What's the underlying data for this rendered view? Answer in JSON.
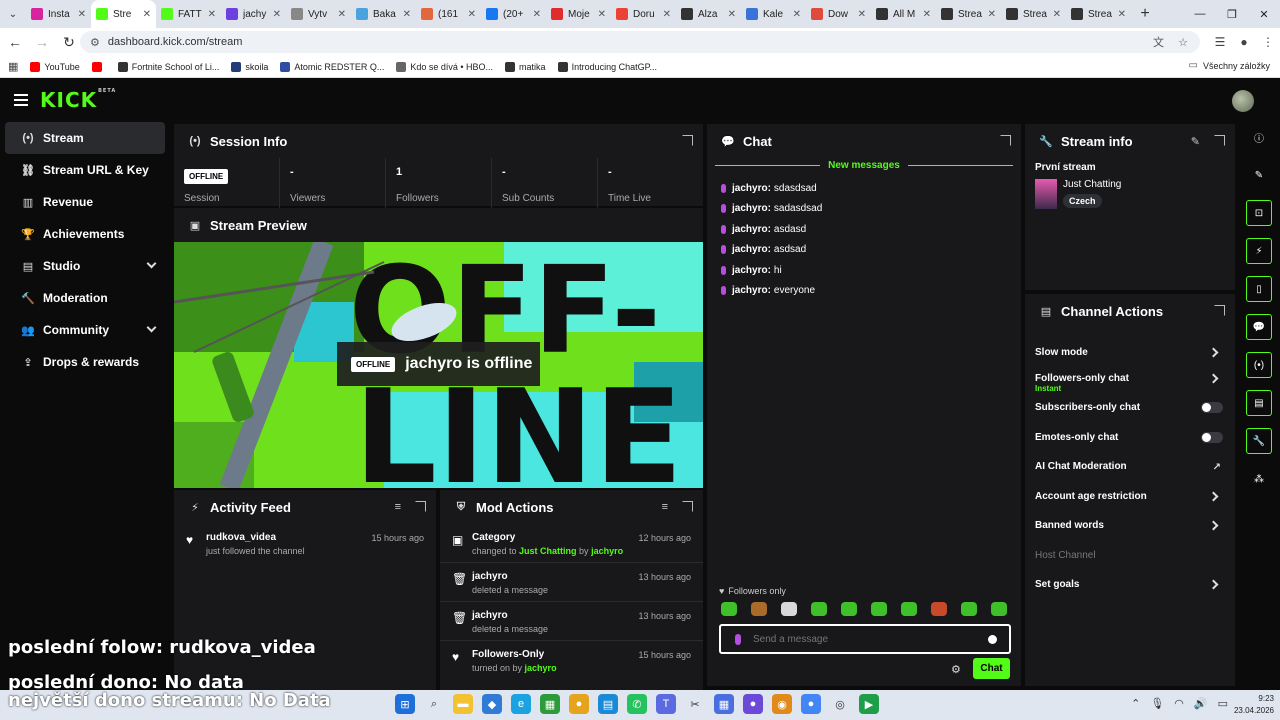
{
  "browser": {
    "tabs": [
      {
        "label": "Insta",
        "color": "#d6249f"
      },
      {
        "label": "Stre",
        "color": "#53fc18",
        "active": true
      },
      {
        "label": "FATT",
        "color": "#53fc18"
      },
      {
        "label": "jachy",
        "color": "#6d3fe0"
      },
      {
        "label": "Vytv",
        "color": "#888888"
      },
      {
        "label": "Baka",
        "color": "#4aa3df"
      },
      {
        "label": "(161",
        "color": "#e2673c"
      },
      {
        "label": "(20+",
        "color": "#1877f2"
      },
      {
        "label": "Moje",
        "color": "#e02c2c"
      },
      {
        "label": "Doru",
        "color": "#ea4335"
      },
      {
        "label": "Alza",
        "color": "#333333"
      },
      {
        "label": "Kale",
        "color": "#3a73d8"
      },
      {
        "label": "Dow",
        "color": "#e04a3c"
      },
      {
        "label": "All M",
        "color": "#333333"
      },
      {
        "label": "Strea",
        "color": "#333333"
      },
      {
        "label": "Strea",
        "color": "#333333"
      },
      {
        "label": "Strea",
        "color": "#333333"
      }
    ],
    "address": "dashboard.kick.com/stream",
    "bookmarks": [
      {
        "label": "YouTube",
        "color": "#ff0000"
      },
      {
        "label": "",
        "color": "#ff0000"
      },
      {
        "label": "Fortnite School of Li...",
        "color": "#333333"
      },
      {
        "label": "skoila",
        "color": "#223c7a"
      },
      {
        "label": "Atomic REDSTER Q...",
        "color": "#2d4fa3"
      },
      {
        "label": "Kdo se dívá • HBO...",
        "color": "#666666"
      },
      {
        "label": "matika",
        "color": "#333333"
      },
      {
        "label": "Introducing ChatGP...",
        "color": "#333333"
      }
    ],
    "all_bookmarks": "Všechny záložky"
  },
  "sidebar": {
    "items": [
      {
        "label": "Stream",
        "icon": "(•)"
      },
      {
        "label": "Stream URL & Key",
        "icon": "⛓"
      },
      {
        "label": "Revenue",
        "icon": "▥"
      },
      {
        "label": "Achievements",
        "icon": "🏆"
      },
      {
        "label": "Studio",
        "icon": "▤"
      },
      {
        "label": "Moderation",
        "icon": "🔨"
      },
      {
        "label": "Community",
        "icon": "👥"
      },
      {
        "label": "Drops & rewards",
        "icon": "⇪"
      }
    ]
  },
  "session": {
    "title": "Session Info",
    "badge": "OFFLINE",
    "stats": [
      {
        "value": "",
        "label": "Session"
      },
      {
        "value": "-",
        "label": "Viewers"
      },
      {
        "value": "1",
        "label": "Followers"
      },
      {
        "value": "-",
        "label": "Sub Counts"
      },
      {
        "value": "-",
        "label": "Time Live"
      }
    ]
  },
  "preview": {
    "title": "Stream Preview",
    "badge": "OFFLINE",
    "offline_text": "jachyro is offline",
    "art_word_1": "OFF-",
    "art_word_2": "LINE"
  },
  "activity": {
    "title": "Activity Feed",
    "entries": [
      {
        "name": "rudkova_videa",
        "desc": "just followed the channel",
        "time": "15 hours ago"
      }
    ]
  },
  "mod": {
    "title": "Mod Actions",
    "entries": [
      {
        "name": "Category",
        "pre": "changed to ",
        "hl1": "Just Chatting",
        "mid": " by ",
        "hl2": "jachyro",
        "time": "12 hours ago",
        "icon": "▣"
      },
      {
        "name": "jachyro",
        "pre": "deleted a message",
        "hl1": "",
        "mid": "",
        "hl2": "",
        "time": "13 hours ago",
        "icon": "🗑"
      },
      {
        "name": "jachyro",
        "pre": "deleted a message",
        "hl1": "",
        "mid": "",
        "hl2": "",
        "time": "13 hours ago",
        "icon": "🗑"
      },
      {
        "name": "Followers-Only",
        "pre": "turned on by ",
        "hl1": "jachyro",
        "mid": "",
        "hl2": "",
        "time": "15 hours ago",
        "icon": "♥"
      }
    ]
  },
  "chat": {
    "title": "Chat",
    "new_messages": "New messages",
    "messages": [
      {
        "user": "jachyro:",
        "text": "sdasdsad"
      },
      {
        "user": "jachyro:",
        "text": "sadasdsad"
      },
      {
        "user": "jachyro:",
        "text": "asdasd"
      },
      {
        "user": "jachyro:",
        "text": "asdsad"
      },
      {
        "user": "jachyro:",
        "text": "hi"
      },
      {
        "user": "jachyro:",
        "text": "everyone"
      }
    ],
    "followers_only": "Followers only",
    "placeholder": "Send a message",
    "send": "Chat"
  },
  "stream_info": {
    "title": "Stream info",
    "stream_title": "První stream",
    "category": "Just Chatting",
    "tag": "Czech"
  },
  "channel_actions": {
    "title": "Channel Actions",
    "items": [
      {
        "label": "Slow mode",
        "kind": "arrow",
        "sub": ""
      },
      {
        "label": "Followers-only chat",
        "kind": "arrow",
        "sub": "Instant"
      },
      {
        "label": "Subscribers-only chat",
        "kind": "toggle",
        "sub": ""
      },
      {
        "label": "Emotes-only chat",
        "kind": "toggle",
        "sub": ""
      },
      {
        "label": "AI Chat Moderation",
        "kind": "ext",
        "sub": ""
      },
      {
        "label": "Account age restriction",
        "kind": "arrow",
        "sub": ""
      },
      {
        "label": "Banned words",
        "kind": "arrow",
        "sub": ""
      },
      {
        "label": "Host Channel",
        "kind": "dim",
        "sub": ""
      },
      {
        "label": "Set goals",
        "kind": "arrow",
        "sub": ""
      }
    ]
  },
  "overlay": {
    "line1": "poslední folow: rudkova_videa",
    "line2": "poslední dono: No data",
    "line3": "největší dono streamu: No Data"
  },
  "taskbar": {
    "time": "9:23",
    "date": "23.04.2026"
  },
  "colors": {
    "accent": "#53fc18",
    "panel": "#18181b",
    "background": "#0b0b0c",
    "mic": "#b64fe0"
  }
}
